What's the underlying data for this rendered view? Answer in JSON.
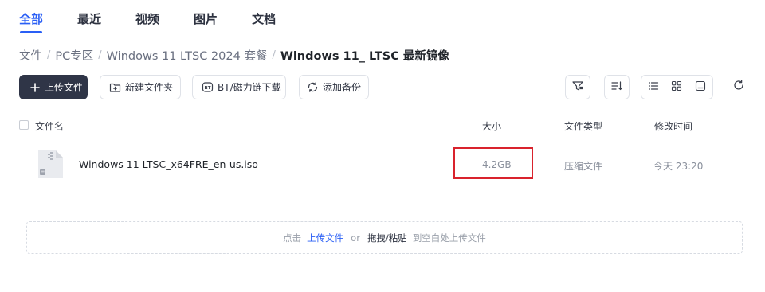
{
  "tabs": [
    {
      "label": "全部",
      "active": true
    },
    {
      "label": "最近",
      "active": false
    },
    {
      "label": "视频",
      "active": false
    },
    {
      "label": "图片",
      "active": false
    },
    {
      "label": "文档",
      "active": false
    }
  ],
  "breadcrumb": {
    "items": [
      "文件",
      "PC专区",
      "Windows 11 LTSC 2024 套餐",
      "Windows 11_ LTSC 最新镜像"
    ],
    "separator": "/"
  },
  "toolbar": {
    "upload_label": "上传文件",
    "new_folder_label": "新建文件夹",
    "bt_label": "BT/磁力链下载",
    "backup_label": "添加备份"
  },
  "view": {
    "mode": "list"
  },
  "table": {
    "headers": {
      "name": "文件名",
      "size": "大小",
      "type": "文件类型",
      "modified": "修改时间"
    },
    "rows": [
      {
        "name": "Windows 11 LTSC_x64FRE_en-us.iso",
        "size": "4.2GB",
        "type": "压缩文件",
        "modified": "今天 23:20"
      }
    ]
  },
  "dropzone": {
    "prefix": "点击",
    "upload_link": "上传文件",
    "or": "or",
    "drag_paste": "拖拽/粘贴",
    "suffix": "到空白处上传文件"
  },
  "colors": {
    "accent": "#2a5ff5",
    "primary_button": "#2f3547",
    "highlight_box": "#d9232d"
  }
}
